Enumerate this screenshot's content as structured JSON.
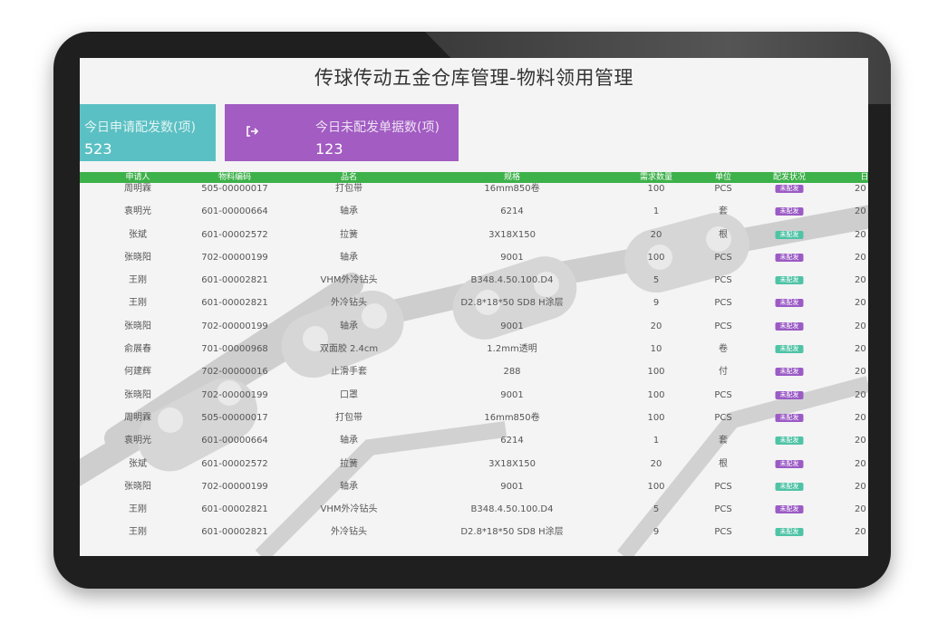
{
  "page": {
    "title": "传球传动五金仓库管理-物料领用管理"
  },
  "stats": {
    "today_applied": {
      "label": "今日申请配发数(项)",
      "value": "523"
    },
    "today_undelivered": {
      "label": "今日未配发单据数(项)",
      "value": "123",
      "icon": "logout-icon"
    }
  },
  "table": {
    "columns": [
      "申请人",
      "物料编码",
      "品名",
      "规格",
      "需求数量",
      "单位",
      "配发状况",
      "日"
    ],
    "rows": [
      {
        "applicant": "周明霖",
        "code": "505-00000017",
        "name": "打包带",
        "spec": "16mm850卷",
        "qty": "100",
        "unit": "PCS",
        "status": "未配发",
        "status_color": "purple",
        "date": "20"
      },
      {
        "applicant": "袁明光",
        "code": "601-00000664",
        "name": "轴承",
        "spec": "6214",
        "qty": "1",
        "unit": "套",
        "status": "未配发",
        "status_color": "purple",
        "date": "20"
      },
      {
        "applicant": "张斌",
        "code": "601-00002572",
        "name": "拉簧",
        "spec": "3X18X150",
        "qty": "20",
        "unit": "根",
        "status": "未配发",
        "status_color": "teal",
        "date": "20"
      },
      {
        "applicant": "张晓阳",
        "code": "702-00000199",
        "name": "轴承",
        "spec": "9001",
        "qty": "100",
        "unit": "PCS",
        "status": "未配发",
        "status_color": "purple",
        "date": "20"
      },
      {
        "applicant": "王刚",
        "code": "601-00002821",
        "name": "VHM外冷钻头",
        "spec": "B348.4.50.100.D4",
        "qty": "5",
        "unit": "PCS",
        "status": "未配发",
        "status_color": "teal",
        "date": "20"
      },
      {
        "applicant": "王刚",
        "code": "601-00002821",
        "name": "外冷钻头",
        "spec": "D2.8*18*50 SD8 H涂层",
        "qty": "9",
        "unit": "PCS",
        "status": "未配发",
        "status_color": "purple",
        "date": "20"
      },
      {
        "applicant": "张晓阳",
        "code": "702-00000199",
        "name": "轴承",
        "spec": "9001",
        "qty": "20",
        "unit": "PCS",
        "status": "未配发",
        "status_color": "purple",
        "date": "20"
      },
      {
        "applicant": "俞展春",
        "code": "701-00000968",
        "name": "双面胶 2.4cm",
        "spec": "1.2mm透明",
        "qty": "10",
        "unit": "卷",
        "status": "未配发",
        "status_color": "teal",
        "date": "20"
      },
      {
        "applicant": "何建辉",
        "code": "702-00000016",
        "name": "止滑手套",
        "spec": "288",
        "qty": "100",
        "unit": "付",
        "status": "未配发",
        "status_color": "purple",
        "date": "20"
      },
      {
        "applicant": "张晓阳",
        "code": "702-00000199",
        "name": "口罩",
        "spec": "9001",
        "qty": "100",
        "unit": "PCS",
        "status": "未配发",
        "status_color": "purple",
        "date": "20"
      },
      {
        "applicant": "周明霖",
        "code": "505-00000017",
        "name": "打包带",
        "spec": "16mm850卷",
        "qty": "100",
        "unit": "PCS",
        "status": "未配发",
        "status_color": "purple",
        "date": "20"
      },
      {
        "applicant": "袁明光",
        "code": "601-00000664",
        "name": "轴承",
        "spec": "6214",
        "qty": "1",
        "unit": "套",
        "status": "未配发",
        "status_color": "teal",
        "date": "20"
      },
      {
        "applicant": "张斌",
        "code": "601-00002572",
        "name": "拉簧",
        "spec": "3X18X150",
        "qty": "20",
        "unit": "根",
        "status": "未配发",
        "status_color": "purple",
        "date": "20"
      },
      {
        "applicant": "张晓阳",
        "code": "702-00000199",
        "name": "轴承",
        "spec": "9001",
        "qty": "100",
        "unit": "PCS",
        "status": "未配发",
        "status_color": "teal",
        "date": "20"
      },
      {
        "applicant": "王刚",
        "code": "601-00002821",
        "name": "VHM外冷钻头",
        "spec": "B348.4.50.100.D4",
        "qty": "5",
        "unit": "PCS",
        "status": "未配发",
        "status_color": "purple",
        "date": "20"
      },
      {
        "applicant": "王刚",
        "code": "601-00002821",
        "name": "外冷钻头",
        "spec": "D2.8*18*50 SD8 H涂层",
        "qty": "9",
        "unit": "PCS",
        "status": "未配发",
        "status_color": "teal",
        "date": "20"
      }
    ]
  },
  "colors": {
    "header_green": "#3db14a",
    "card_teal": "#5bc0c3",
    "card_purple": "#a25cc2",
    "badge_teal": "#4fc3a6",
    "badge_purple": "#9b5bc5"
  }
}
